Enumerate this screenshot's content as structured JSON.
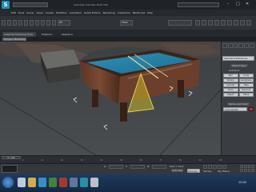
{
  "app": {
    "logo_letter": "S",
    "title": "Autodesk 3ds Max 2010 x64",
    "window_min": "–",
    "window_max": "□",
    "window_close": "✕"
  },
  "menu": {
    "items": [
      "Edit",
      "Tools",
      "Group",
      "Views",
      "Create",
      "Modifiers",
      "Animation",
      "Graph Editors",
      "Rendering",
      "Customize",
      "MAXScript",
      "Help"
    ]
  },
  "toolbar": {
    "selection_filter": "All",
    "view_mode": "View"
  },
  "ribbon": {
    "tabs": [
      "Graphite Modeling Tools",
      "Freeform",
      "Selection"
    ],
    "subtab": "Polygon Modeling"
  },
  "command_panel": {
    "dropdown": "Standard Primitives",
    "rollout_object_type": "Object Type",
    "autogrid": "AutoGrid",
    "buttons": [
      "Box",
      "Cone",
      "Sphere",
      "GeoSphere",
      "Cylinder",
      "Tube",
      "Torus",
      "Pyramid",
      "Teapot",
      "Plane"
    ],
    "rollout_name_color": "Name and Color",
    "name_value": "Cylinder001",
    "accent_color": "#cf2a2a"
  },
  "status": {
    "frame_counter": "0 / 100",
    "x_label": "X:",
    "y_label": "Y:",
    "z_label": "Z:",
    "grid": "Grid = 10.0",
    "auto_key": "Auto Key",
    "selected": "Selected",
    "set_key": "Set Key",
    "key_filters": "Key Filters..."
  },
  "timeline": {
    "ticks": [
      "0",
      "10",
      "20",
      "30",
      "40",
      "50",
      "60",
      "70",
      "80",
      "90",
      "100"
    ]
  },
  "taskbar": {
    "start_icon": "windows-start-icon",
    "clock": "12:00"
  }
}
